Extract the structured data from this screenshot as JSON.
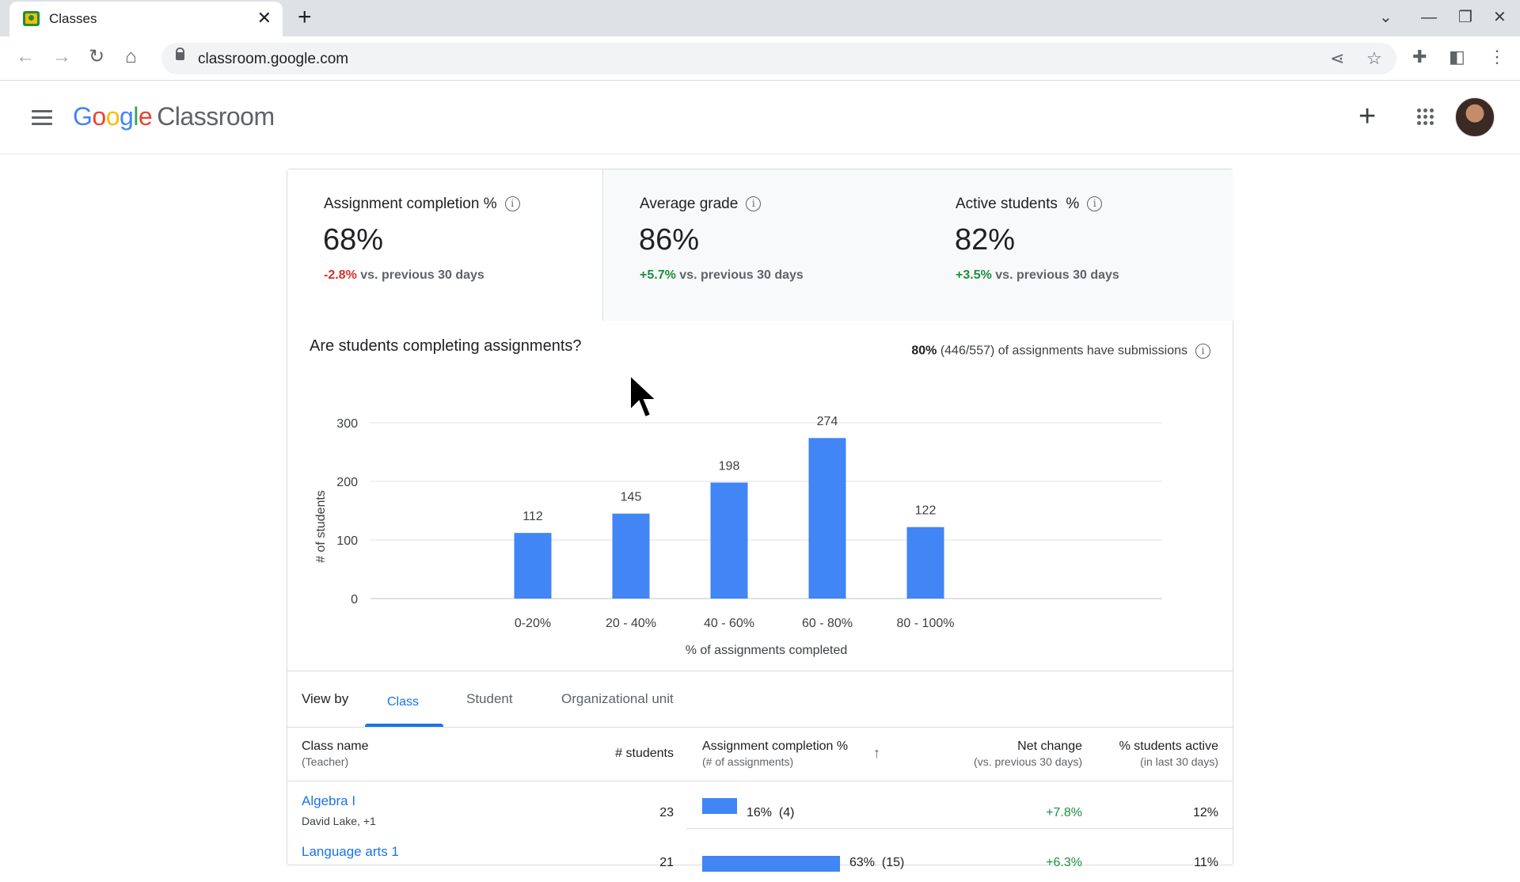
{
  "browser": {
    "tab_title": "Classes",
    "url": "classroom.google.com"
  },
  "app": {
    "logo_google": [
      "G",
      "o",
      "o",
      "g",
      "l",
      "e"
    ],
    "logo_product": "Classroom"
  },
  "metrics": [
    {
      "label": "Assignment completion %",
      "value": "68%",
      "delta": "-2.8%",
      "delta_suffix": "vs. previous 30 days",
      "delta_color": "#d93025"
    },
    {
      "label": "Average grade",
      "value": "86%",
      "delta": "+5.7%",
      "delta_suffix": "vs. previous 30 days",
      "delta_color": "#1e8e3e"
    },
    {
      "label": "Active students  %",
      "value": "82%",
      "delta": "+3.5%",
      "delta_suffix": "vs. previous 30 days",
      "delta_color": "#1e8e3e"
    }
  ],
  "chart_section": {
    "title": "Are students completing assignments?",
    "submissions_pct": "80%",
    "submissions_text": "(446/557) of assignments have submissions"
  },
  "chart_data": {
    "type": "bar",
    "categories": [
      "0-20%",
      "20 - 40%",
      "40 - 60%",
      "60 - 80%",
      "80 - 100%"
    ],
    "values": [
      112,
      145,
      198,
      274,
      122
    ],
    "xlabel": "% of assignments completed",
    "ylabel": "# of students",
    "ylim": [
      0,
      300
    ],
    "yticks": [
      0,
      100,
      200,
      300
    ],
    "grid": true,
    "bar_color": "#4285f4"
  },
  "view_by": {
    "label": "View by",
    "tabs": [
      "Class",
      "Student",
      "Organizational unit"
    ],
    "active": "Class"
  },
  "table": {
    "headers": {
      "class_name": "Class name",
      "class_name_sub": "(Teacher)",
      "students": "# students",
      "completion": "Assignment completion %",
      "completion_sub": "(# of assignments)",
      "net_change": "Net change",
      "net_change_sub": "(vs. previous 30 days)",
      "active": "% students active",
      "active_sub": "(in last 30 days)"
    },
    "rows": [
      {
        "name": "Algebra I",
        "teacher": "David Lake, +1",
        "students": "23",
        "completion_pct": 16,
        "completion_label": "16%",
        "assignments": "(4)",
        "net_change": "+7.8%",
        "active": "12%"
      },
      {
        "name": "Language arts 1",
        "teacher": "",
        "students": "21",
        "completion_pct": 63,
        "completion_label": "63%",
        "assignments": "(15)",
        "net_change": "+6.3%",
        "active": "11%"
      }
    ]
  }
}
